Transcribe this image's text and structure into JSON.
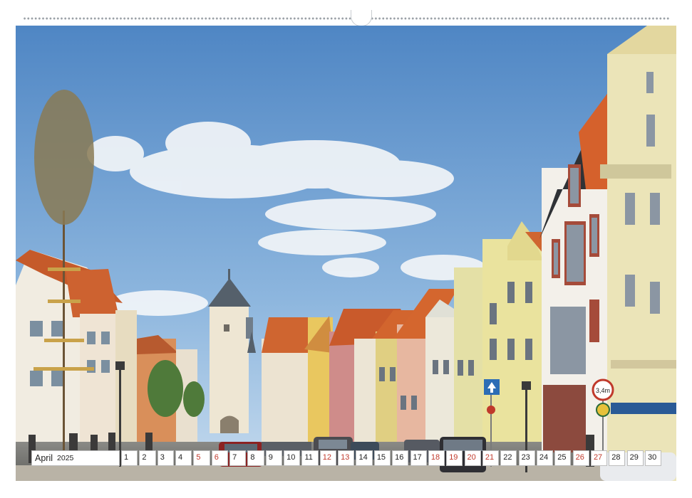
{
  "calendar": {
    "month": "April",
    "year": "2025",
    "days": [
      {
        "num": "1",
        "weekend": false
      },
      {
        "num": "2",
        "weekend": false
      },
      {
        "num": "3",
        "weekend": false
      },
      {
        "num": "4",
        "weekend": false
      },
      {
        "num": "5",
        "weekend": true
      },
      {
        "num": "6",
        "weekend": true
      },
      {
        "num": "7",
        "weekend": false
      },
      {
        "num": "8",
        "weekend": false
      },
      {
        "num": "9",
        "weekend": false
      },
      {
        "num": "10",
        "weekend": false
      },
      {
        "num": "11",
        "weekend": false
      },
      {
        "num": "12",
        "weekend": true
      },
      {
        "num": "13",
        "weekend": true
      },
      {
        "num": "14",
        "weekend": false
      },
      {
        "num": "15",
        "weekend": false
      },
      {
        "num": "16",
        "weekend": false
      },
      {
        "num": "17",
        "weekend": false
      },
      {
        "num": "18",
        "weekend": true
      },
      {
        "num": "19",
        "weekend": true
      },
      {
        "num": "20",
        "weekend": true
      },
      {
        "num": "21",
        "weekend": true
      },
      {
        "num": "22",
        "weekend": false
      },
      {
        "num": "23",
        "weekend": false
      },
      {
        "num": "24",
        "weekend": false
      },
      {
        "num": "25",
        "weekend": false
      },
      {
        "num": "26",
        "weekend": true
      },
      {
        "num": "27",
        "weekend": true
      },
      {
        "num": "28",
        "weekend": false
      },
      {
        "num": "29",
        "weekend": false
      },
      {
        "num": "30",
        "weekend": false
      }
    ]
  },
  "photo": {
    "description_icon": "street-photo",
    "sign_speed": "3,4m",
    "colors": {
      "sky_top": "#5b8fc7",
      "sky_bottom": "#a9c8e6",
      "roof": "#d4662e",
      "holiday_red": "#c0392b"
    }
  }
}
